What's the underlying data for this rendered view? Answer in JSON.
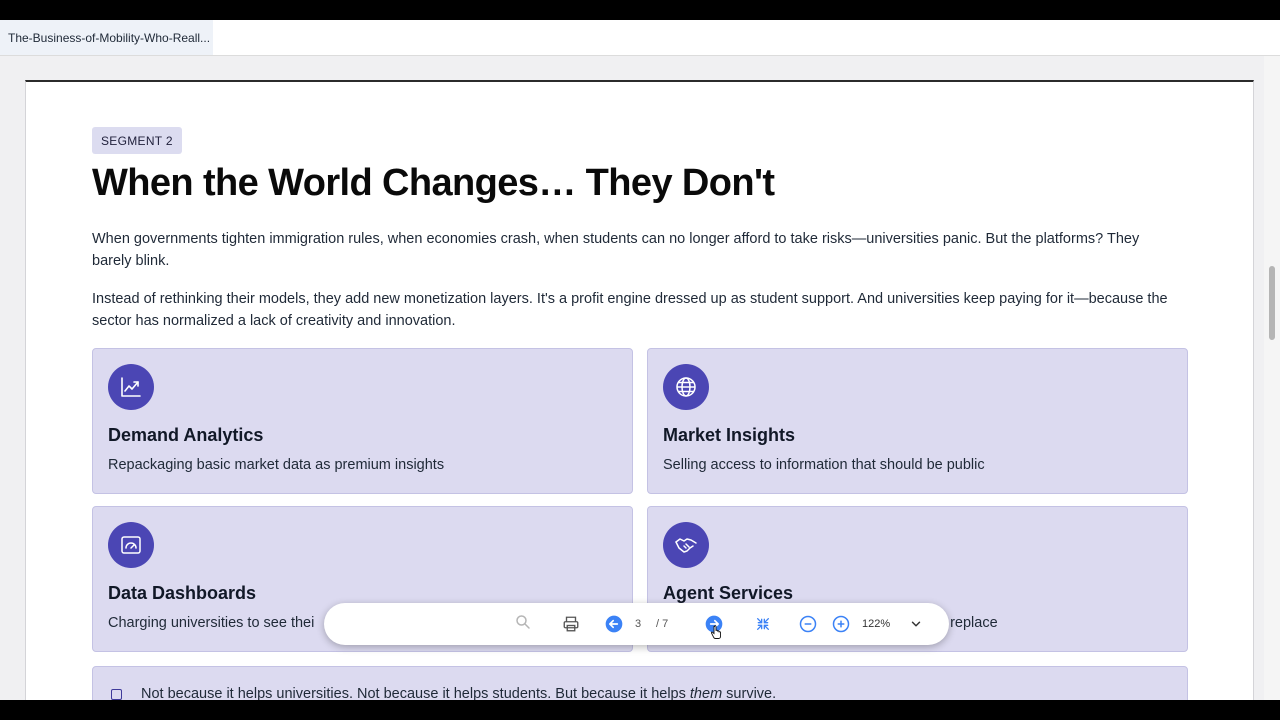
{
  "tab": {
    "title": "The-Business-of-Mobility-Who-Reall..."
  },
  "document": {
    "segment_label": "SEGMENT 2",
    "heading": "When the World Changes… They Don't",
    "paragraphs": [
      "When governments tighten immigration rules, when economies crash, when students can no longer afford to take risks—universities panic. But the platforms? They barely blink.",
      "Instead of rethinking their models, they add new monetization layers. It's a profit engine dressed up as student support. And universities keep paying for it—because the sector has normalized a lack of creativity and innovation."
    ],
    "cards": [
      {
        "title": "Demand Analytics",
        "desc": "Repackaging basic market data as premium insights",
        "icon": "line-chart-icon"
      },
      {
        "title": "Market Insights",
        "desc": "Selling access to information that should be public",
        "icon": "globe-icon"
      },
      {
        "title": "Data Dashboards",
        "desc": "Charging universities to see thei",
        "icon": "dashboard-icon"
      },
      {
        "title": "Agent Services",
        "desc": "o replace",
        "icon": "handshake-icon"
      }
    ],
    "note": {
      "before": "Not because it helps universities. Not because it helps students. But because it helps ",
      "emph": "them",
      "after": " survive."
    }
  },
  "toolbar": {
    "current_page": "3",
    "total_pages": "/ 7",
    "zoom": "122%"
  },
  "colors": {
    "accent": "#4b46b4",
    "card_bg": "#dcdaf0",
    "nav_blue": "#3b82f6"
  }
}
